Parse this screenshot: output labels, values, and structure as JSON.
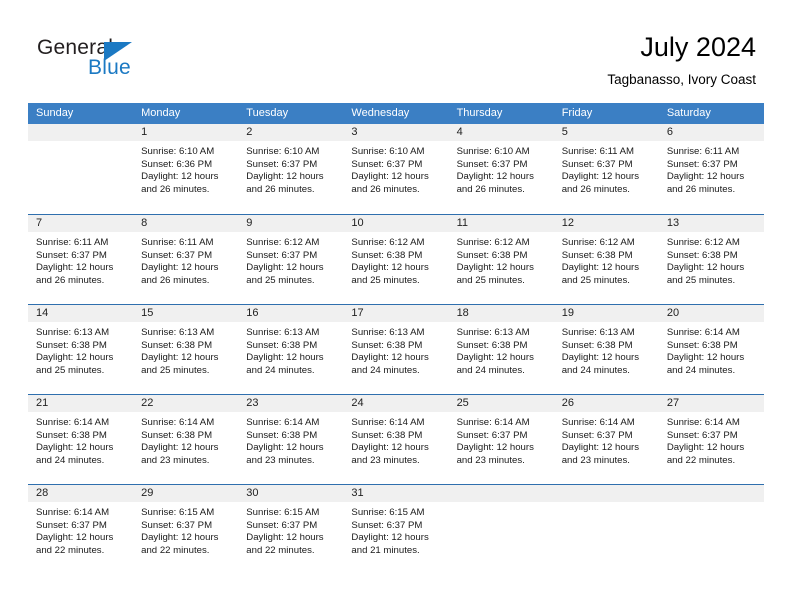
{
  "logo": {
    "primary_text": "General",
    "secondary_text": "Blue",
    "accent_color": "#1b79c3"
  },
  "header": {
    "title": "July 2024",
    "subtitle": "Tagbanasso, Ivory Coast"
  },
  "calendar": {
    "header_color": "#3b7fc4",
    "weekdays": [
      "Sunday",
      "Monday",
      "Tuesday",
      "Wednesday",
      "Thursday",
      "Friday",
      "Saturday"
    ],
    "weeks": [
      [
        {
          "day": "",
          "empty": true,
          "sunrise": "",
          "sunset": "",
          "daylight_line1": "",
          "daylight_line2": ""
        },
        {
          "day": "1",
          "sunrise": "Sunrise: 6:10 AM",
          "sunset": "Sunset: 6:36 PM",
          "daylight_line1": "Daylight: 12 hours",
          "daylight_line2": "and 26 minutes."
        },
        {
          "day": "2",
          "sunrise": "Sunrise: 6:10 AM",
          "sunset": "Sunset: 6:37 PM",
          "daylight_line1": "Daylight: 12 hours",
          "daylight_line2": "and 26 minutes."
        },
        {
          "day": "3",
          "sunrise": "Sunrise: 6:10 AM",
          "sunset": "Sunset: 6:37 PM",
          "daylight_line1": "Daylight: 12 hours",
          "daylight_line2": "and 26 minutes."
        },
        {
          "day": "4",
          "sunrise": "Sunrise: 6:10 AM",
          "sunset": "Sunset: 6:37 PM",
          "daylight_line1": "Daylight: 12 hours",
          "daylight_line2": "and 26 minutes."
        },
        {
          "day": "5",
          "sunrise": "Sunrise: 6:11 AM",
          "sunset": "Sunset: 6:37 PM",
          "daylight_line1": "Daylight: 12 hours",
          "daylight_line2": "and 26 minutes."
        },
        {
          "day": "6",
          "sunrise": "Sunrise: 6:11 AM",
          "sunset": "Sunset: 6:37 PM",
          "daylight_line1": "Daylight: 12 hours",
          "daylight_line2": "and 26 minutes."
        }
      ],
      [
        {
          "day": "7",
          "sunrise": "Sunrise: 6:11 AM",
          "sunset": "Sunset: 6:37 PM",
          "daylight_line1": "Daylight: 12 hours",
          "daylight_line2": "and 26 minutes."
        },
        {
          "day": "8",
          "sunrise": "Sunrise: 6:11 AM",
          "sunset": "Sunset: 6:37 PM",
          "daylight_line1": "Daylight: 12 hours",
          "daylight_line2": "and 26 minutes."
        },
        {
          "day": "9",
          "sunrise": "Sunrise: 6:12 AM",
          "sunset": "Sunset: 6:37 PM",
          "daylight_line1": "Daylight: 12 hours",
          "daylight_line2": "and 25 minutes."
        },
        {
          "day": "10",
          "sunrise": "Sunrise: 6:12 AM",
          "sunset": "Sunset: 6:38 PM",
          "daylight_line1": "Daylight: 12 hours",
          "daylight_line2": "and 25 minutes."
        },
        {
          "day": "11",
          "sunrise": "Sunrise: 6:12 AM",
          "sunset": "Sunset: 6:38 PM",
          "daylight_line1": "Daylight: 12 hours",
          "daylight_line2": "and 25 minutes."
        },
        {
          "day": "12",
          "sunrise": "Sunrise: 6:12 AM",
          "sunset": "Sunset: 6:38 PM",
          "daylight_line1": "Daylight: 12 hours",
          "daylight_line2": "and 25 minutes."
        },
        {
          "day": "13",
          "sunrise": "Sunrise: 6:12 AM",
          "sunset": "Sunset: 6:38 PM",
          "daylight_line1": "Daylight: 12 hours",
          "daylight_line2": "and 25 minutes."
        }
      ],
      [
        {
          "day": "14",
          "sunrise": "Sunrise: 6:13 AM",
          "sunset": "Sunset: 6:38 PM",
          "daylight_line1": "Daylight: 12 hours",
          "daylight_line2": "and 25 minutes."
        },
        {
          "day": "15",
          "sunrise": "Sunrise: 6:13 AM",
          "sunset": "Sunset: 6:38 PM",
          "daylight_line1": "Daylight: 12 hours",
          "daylight_line2": "and 25 minutes."
        },
        {
          "day": "16",
          "sunrise": "Sunrise: 6:13 AM",
          "sunset": "Sunset: 6:38 PM",
          "daylight_line1": "Daylight: 12 hours",
          "daylight_line2": "and 24 minutes."
        },
        {
          "day": "17",
          "sunrise": "Sunrise: 6:13 AM",
          "sunset": "Sunset: 6:38 PM",
          "daylight_line1": "Daylight: 12 hours",
          "daylight_line2": "and 24 minutes."
        },
        {
          "day": "18",
          "sunrise": "Sunrise: 6:13 AM",
          "sunset": "Sunset: 6:38 PM",
          "daylight_line1": "Daylight: 12 hours",
          "daylight_line2": "and 24 minutes."
        },
        {
          "day": "19",
          "sunrise": "Sunrise: 6:13 AM",
          "sunset": "Sunset: 6:38 PM",
          "daylight_line1": "Daylight: 12 hours",
          "daylight_line2": "and 24 minutes."
        },
        {
          "day": "20",
          "sunrise": "Sunrise: 6:14 AM",
          "sunset": "Sunset: 6:38 PM",
          "daylight_line1": "Daylight: 12 hours",
          "daylight_line2": "and 24 minutes."
        }
      ],
      [
        {
          "day": "21",
          "sunrise": "Sunrise: 6:14 AM",
          "sunset": "Sunset: 6:38 PM",
          "daylight_line1": "Daylight: 12 hours",
          "daylight_line2": "and 24 minutes."
        },
        {
          "day": "22",
          "sunrise": "Sunrise: 6:14 AM",
          "sunset": "Sunset: 6:38 PM",
          "daylight_line1": "Daylight: 12 hours",
          "daylight_line2": "and 23 minutes."
        },
        {
          "day": "23",
          "sunrise": "Sunrise: 6:14 AM",
          "sunset": "Sunset: 6:38 PM",
          "daylight_line1": "Daylight: 12 hours",
          "daylight_line2": "and 23 minutes."
        },
        {
          "day": "24",
          "sunrise": "Sunrise: 6:14 AM",
          "sunset": "Sunset: 6:38 PM",
          "daylight_line1": "Daylight: 12 hours",
          "daylight_line2": "and 23 minutes."
        },
        {
          "day": "25",
          "sunrise": "Sunrise: 6:14 AM",
          "sunset": "Sunset: 6:37 PM",
          "daylight_line1": "Daylight: 12 hours",
          "daylight_line2": "and 23 minutes."
        },
        {
          "day": "26",
          "sunrise": "Sunrise: 6:14 AM",
          "sunset": "Sunset: 6:37 PM",
          "daylight_line1": "Daylight: 12 hours",
          "daylight_line2": "and 23 minutes."
        },
        {
          "day": "27",
          "sunrise": "Sunrise: 6:14 AM",
          "sunset": "Sunset: 6:37 PM",
          "daylight_line1": "Daylight: 12 hours",
          "daylight_line2": "and 22 minutes."
        }
      ],
      [
        {
          "day": "28",
          "sunrise": "Sunrise: 6:14 AM",
          "sunset": "Sunset: 6:37 PM",
          "daylight_line1": "Daylight: 12 hours",
          "daylight_line2": "and 22 minutes."
        },
        {
          "day": "29",
          "sunrise": "Sunrise: 6:15 AM",
          "sunset": "Sunset: 6:37 PM",
          "daylight_line1": "Daylight: 12 hours",
          "daylight_line2": "and 22 minutes."
        },
        {
          "day": "30",
          "sunrise": "Sunrise: 6:15 AM",
          "sunset": "Sunset: 6:37 PM",
          "daylight_line1": "Daylight: 12 hours",
          "daylight_line2": "and 22 minutes."
        },
        {
          "day": "31",
          "sunrise": "Sunrise: 6:15 AM",
          "sunset": "Sunset: 6:37 PM",
          "daylight_line1": "Daylight: 12 hours",
          "daylight_line2": "and 21 minutes."
        },
        {
          "day": "",
          "empty": true,
          "sunrise": "",
          "sunset": "",
          "daylight_line1": "",
          "daylight_line2": ""
        },
        {
          "day": "",
          "empty": true,
          "sunrise": "",
          "sunset": "",
          "daylight_line1": "",
          "daylight_line2": ""
        },
        {
          "day": "",
          "empty": true,
          "sunrise": "",
          "sunset": "",
          "daylight_line1": "",
          "daylight_line2": ""
        }
      ]
    ]
  }
}
